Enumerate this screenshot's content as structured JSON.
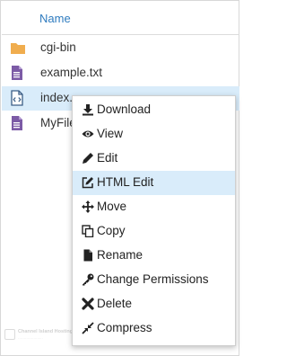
{
  "header": {
    "name_label": "Name"
  },
  "files": [
    {
      "label": "cgi-bin",
      "icon": "folder-icon"
    },
    {
      "label": "example.txt",
      "icon": "text-file-icon"
    },
    {
      "label": "index.",
      "icon": "html-file-icon"
    },
    {
      "label": "MyFile",
      "icon": "text-file-icon"
    }
  ],
  "context_menu": {
    "items": [
      {
        "label": "Download",
        "icon": "download-icon"
      },
      {
        "label": "View",
        "icon": "eye-icon"
      },
      {
        "label": "Edit",
        "icon": "pencil-icon"
      },
      {
        "label": "HTML Edit",
        "icon": "edit-square-icon"
      },
      {
        "label": "Move",
        "icon": "move-arrows-icon"
      },
      {
        "label": "Copy",
        "icon": "copy-icon"
      },
      {
        "label": "Rename",
        "icon": "file-icon"
      },
      {
        "label": "Change Permissions",
        "icon": "key-icon"
      },
      {
        "label": "Delete",
        "icon": "x-icon"
      },
      {
        "label": "Compress",
        "icon": "compress-icon"
      }
    ]
  },
  "watermark": {
    "text": "Channel Island Hosting"
  },
  "colors": {
    "accent": "#2e7bbf",
    "folder": "#f0ad4e",
    "file": "#7c5ba6",
    "highlight": "#d9ecfa"
  }
}
